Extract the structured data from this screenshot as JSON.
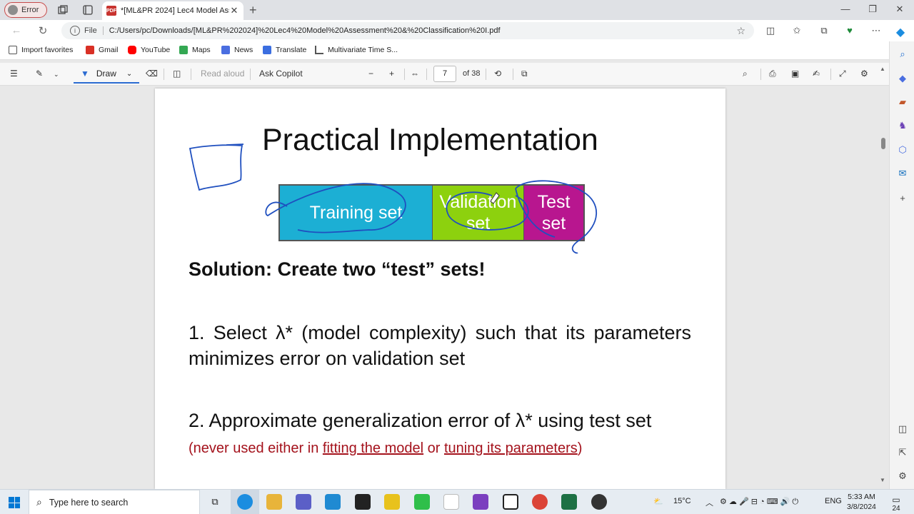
{
  "browser": {
    "profile_label": "Error",
    "tab_title": "*[ML&PR 2024] Lec4 Model Asse",
    "tab_icon": "pdf-icon",
    "url_scheme_label": "File",
    "url": "C:/Users/pc/Downloads/[ML&PR%202024]%20Lec4%20Model%20Assessment%20&%20Classification%20I.pdf"
  },
  "bookmarks": [
    {
      "label": "Import favorites",
      "icon": "folder-icon",
      "color": "#555555"
    },
    {
      "label": "Gmail",
      "icon": "gmail-icon",
      "color": "#d93025"
    },
    {
      "label": "YouTube",
      "icon": "youtube-icon",
      "color": "#ff0000"
    },
    {
      "label": "Maps",
      "icon": "maps-icon",
      "color": "#34a853"
    },
    {
      "label": "News",
      "icon": "news-icon",
      "color": "#4a6ee0"
    },
    {
      "label": "Translate",
      "icon": "translate-icon",
      "color": "#3b6ee0"
    },
    {
      "label": "Multivariate Time S...",
      "icon": "chart-icon",
      "color": "#555555"
    }
  ],
  "pdf_toolbar": {
    "draw_label": "Draw",
    "read_aloud_label": "Read aloud",
    "ask_copilot_label": "Ask Copilot",
    "page_current": "7",
    "page_total_label": "of 38"
  },
  "slide": {
    "title": "Practical Implementation",
    "segments": {
      "training": "Training set",
      "validation": "Validation set",
      "test": "Test set"
    },
    "colors": {
      "training": "#1cafd4",
      "validation": "#8dd10e",
      "test": "#b8168f",
      "ink": "#1f4fbf",
      "note": "#a4121c"
    },
    "solution": "Solution: Create two “test” sets!",
    "point1": "1. Select λ* (model complexity) such that its parameters minimizes error on validation set",
    "point2_main": "2. Approximate generalization error of λ* using test set",
    "point2_note_open": "(never used either in ",
    "point2_note_link1": "fitting the model",
    "point2_note_mid": " or ",
    "point2_note_link2": "tuning its parameters",
    "point2_note_close": ")"
  },
  "taskbar": {
    "search_placeholder": "Type here to search",
    "weather": "15°C",
    "language": "ENG",
    "time": "5:33 AM",
    "date": "3/8/2024",
    "notification_count": "24"
  }
}
